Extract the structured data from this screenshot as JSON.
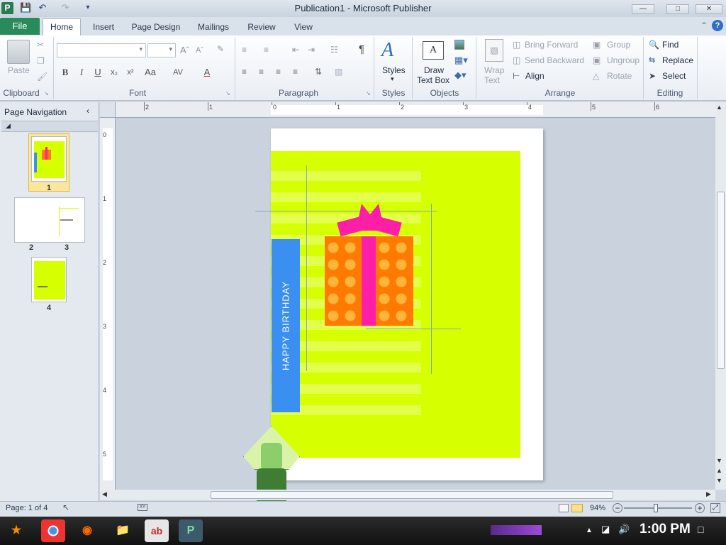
{
  "window": {
    "title": "Publication1 - Microsoft Publisher",
    "app_icon": "P"
  },
  "qat": {
    "save": "save-icon",
    "undo": "undo-icon",
    "redo": "redo-icon"
  },
  "tabs": {
    "file": "File",
    "home": "Home",
    "insert": "Insert",
    "page_design": "Page Design",
    "mailings": "Mailings",
    "review": "Review",
    "view": "View"
  },
  "ribbon": {
    "clipboard": {
      "label": "Clipboard",
      "paste": "Paste"
    },
    "font": {
      "label": "Font",
      "bold": "B",
      "italic": "I",
      "underline": "U",
      "subscript": "x₂",
      "superscript": "x²",
      "case": "Aa",
      "spacing": "AV",
      "color": "A"
    },
    "paragraph": {
      "label": "Paragraph",
      "pilcrow": "¶"
    },
    "styles": {
      "label": "Styles",
      "button": "Styles"
    },
    "objects": {
      "label": "Objects",
      "draw_text_box_1": "Draw",
      "draw_text_box_2": "Text Box"
    },
    "arrange": {
      "label": "Arrange",
      "wrap_text_1": "Wrap",
      "wrap_text_2": "Text",
      "bring_forward": "Bring Forward",
      "send_backward": "Send Backward",
      "align": "Align",
      "group": "Group",
      "ungroup": "Ungroup",
      "rotate": "Rotate"
    },
    "editing": {
      "label": "Editing",
      "find": "Find",
      "replace": "Replace",
      "select": "Select"
    }
  },
  "nav": {
    "title": "Page Navigation",
    "pages": [
      "1",
      "2",
      "3",
      "4"
    ]
  },
  "rulers": {
    "h": [
      "2",
      "1",
      "0",
      "1",
      "2",
      "3",
      "4",
      "5",
      "6"
    ],
    "v": [
      "0",
      "1",
      "2",
      "3",
      "4",
      "5"
    ]
  },
  "card": {
    "text": "HAPPY BIRTHDAY",
    "background": "#d6ff00",
    "band": "#3b8ff0",
    "gift": "#ff7a00",
    "ribbon": "#ff1ea8"
  },
  "status": {
    "page": "Page: 1 of 4",
    "zoom": "94%"
  },
  "taskbar": {
    "time": "1:00 PM"
  }
}
